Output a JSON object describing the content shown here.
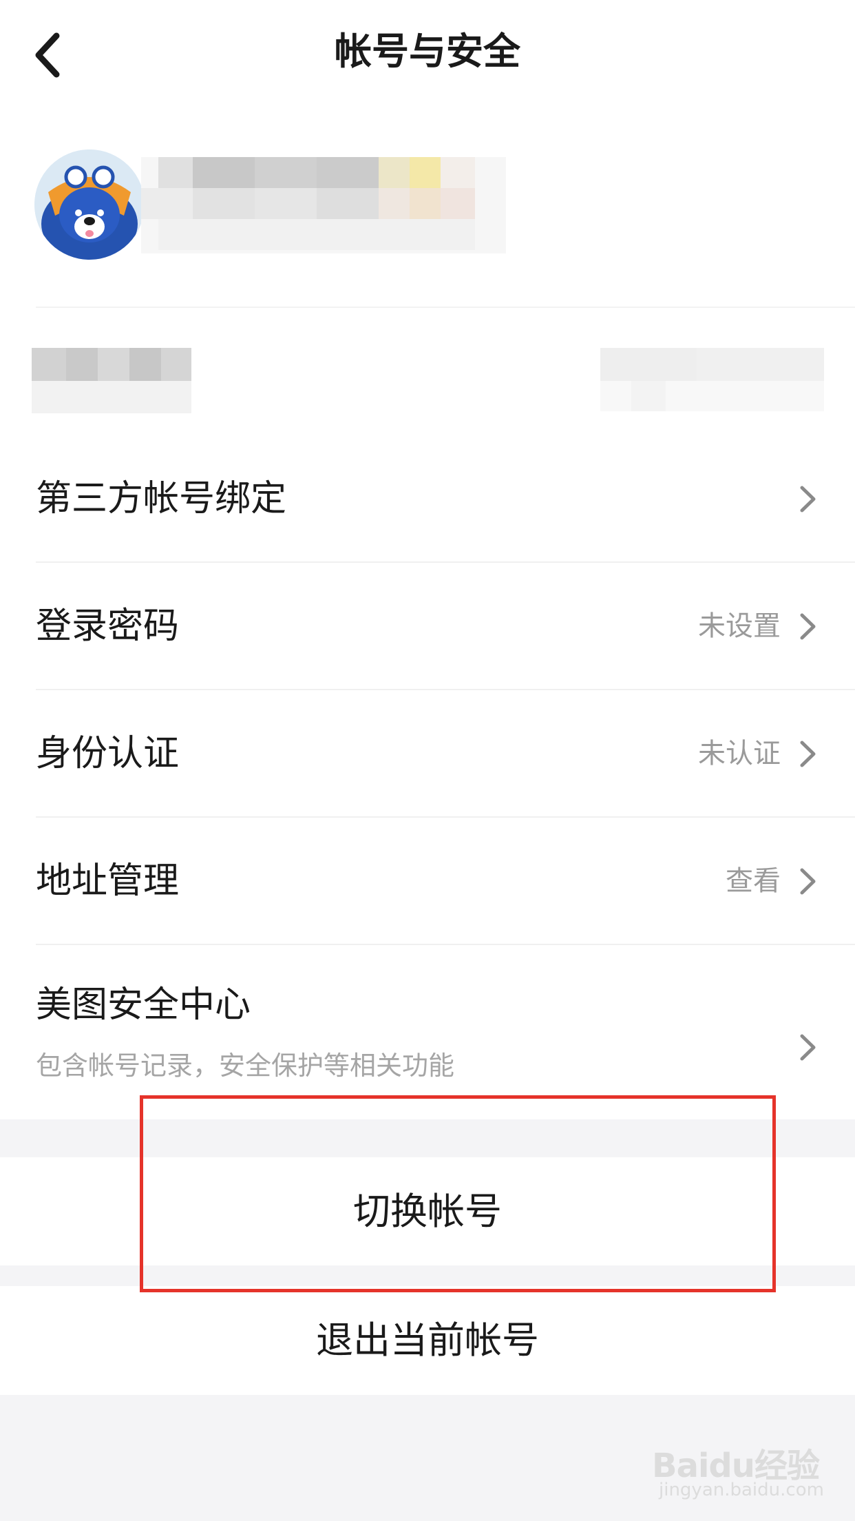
{
  "header": {
    "title": "帐号与安全"
  },
  "menu": {
    "items": [
      {
        "label": "第三方帐号绑定",
        "value": ""
      },
      {
        "label": "登录密码",
        "value": "未设置"
      },
      {
        "label": "身份认证",
        "value": "未认证"
      },
      {
        "label": "地址管理",
        "value": "查看"
      }
    ],
    "security_center": {
      "label": "美图安全中心",
      "subtitle": "包含帐号记录，安全保护等相关功能"
    }
  },
  "actions": {
    "switch_account": "切换帐号",
    "logout": "退出当前帐号"
  },
  "watermark": {
    "main": "Baidu经验",
    "sub": "jingyan.baidu.com"
  },
  "colors": {
    "highlight": "#e5332a",
    "avatar_bg": "#2553b0",
    "avatar_accent": "#f09a2e"
  }
}
